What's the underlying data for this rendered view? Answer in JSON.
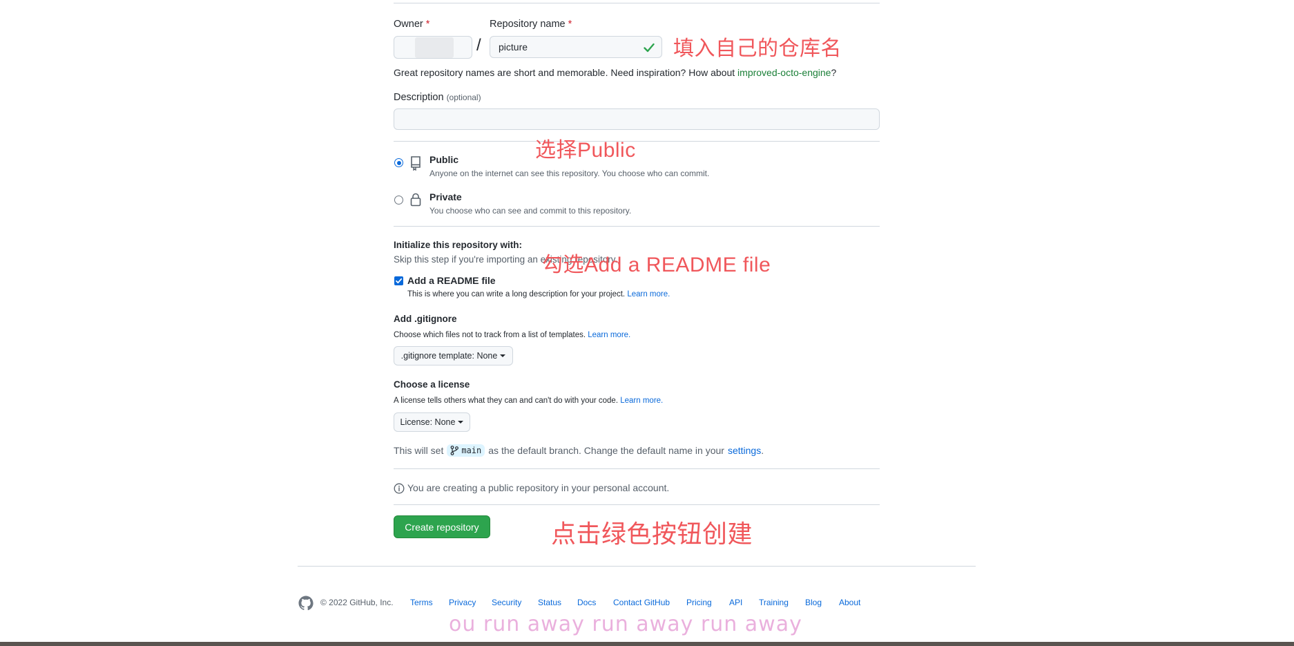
{
  "owner": {
    "label": "Owner",
    "required": "*",
    "value": ""
  },
  "slash": "/",
  "repo": {
    "label": "Repository name",
    "required": "*",
    "value": "picture"
  },
  "annotations": {
    "repo_name": "填入自己的仓库名",
    "public": "选择Public",
    "readme": "勾选Add  a README file",
    "create": "点击绿色按钮创建",
    "color": "#f0575b"
  },
  "suggestion": {
    "prefix": "Great repository names are short and memorable. Need inspiration? How about ",
    "name": "improved-octo-engine",
    "suffix": "?"
  },
  "description": {
    "label": "Description",
    "optional": "(optional)",
    "value": ""
  },
  "visibility": {
    "public": {
      "label": "Public",
      "desc": "Anyone on the internet can see this repository. You choose who can commit.",
      "selected": true
    },
    "private": {
      "label": "Private",
      "desc": "You choose who can see and commit to this repository.",
      "selected": false
    }
  },
  "init": {
    "title": "Initialize this repository with:",
    "skip": "Skip this step if you're importing an existing repository.",
    "readme": {
      "label": "Add a README file",
      "desc": "This is where you can write a long description for your project.",
      "link": "Learn more.",
      "checked": true
    }
  },
  "gitignore": {
    "title": "Add .gitignore",
    "desc": "Choose which files not to track from a list of templates.",
    "link": "Learn more.",
    "button": ".gitignore template: None"
  },
  "license": {
    "title": "Choose a license",
    "desc": "A license tells others what they can and can't do with your code.",
    "link": "Learn more.",
    "button": "License: None"
  },
  "branch": {
    "prefix": "This will set",
    "name": "main",
    "middle": "as the default branch. Change the default name in your",
    "link": "settings",
    "suffix": "."
  },
  "info": "You are creating a public repository in your personal account.",
  "create_button": "Create repository",
  "footer": {
    "copyright": "© 2022 GitHub, Inc.",
    "links": [
      "Terms",
      "Privacy",
      "Security",
      "Status",
      "Docs",
      "Contact GitHub",
      "Pricing",
      "API",
      "Training",
      "Blog",
      "About"
    ]
  },
  "watermark": "ou run away run away run away",
  "colors": {
    "accent": "#0969da",
    "primary_button": "#2da44e",
    "suggestion": "#1a7f37",
    "watermark": "#e7a3d8"
  }
}
